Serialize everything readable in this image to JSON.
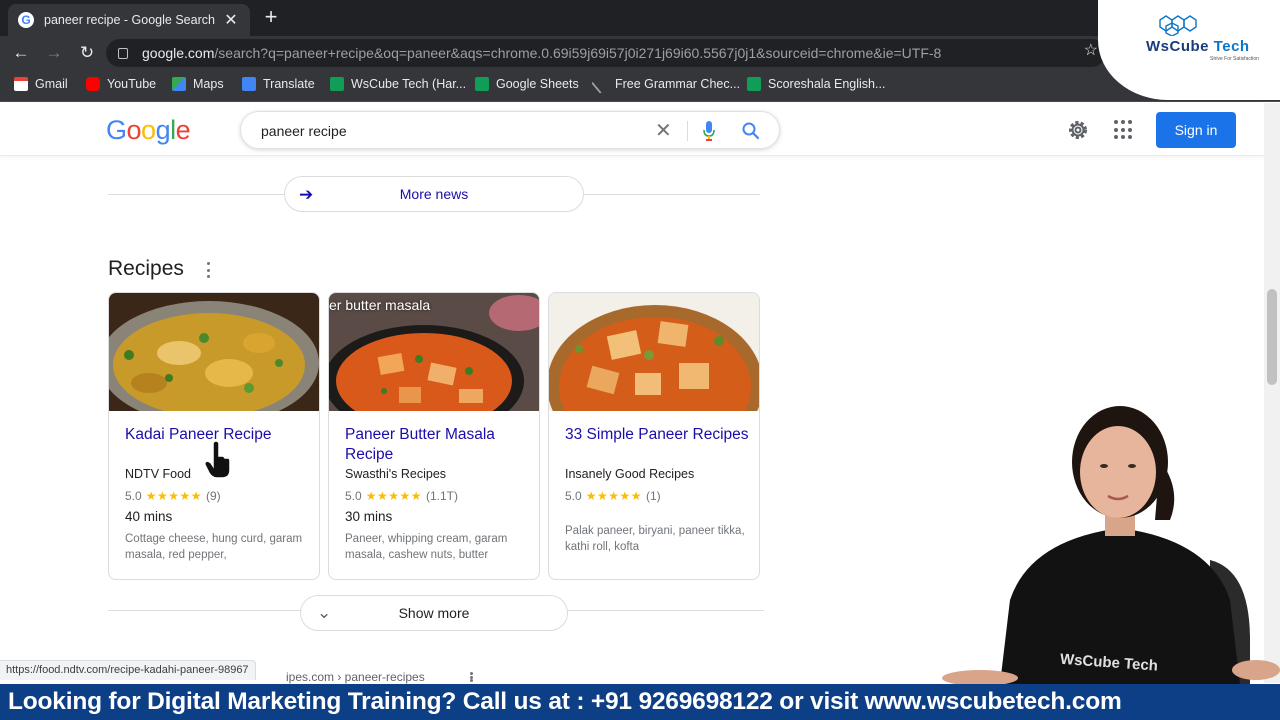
{
  "browser": {
    "tab_title": "paneer recipe - Google Search",
    "tab_close": "✕",
    "new_tab": "+",
    "url_host": "google.com",
    "url_rest": "/search?q=paneer+recipe&oq=paneer&aqs=chrome.0.69i59j69i57j0i271j69i60.5567j0j1&sourceid=chrome&ie=UTF-8",
    "bookmarks": [
      {
        "label": "Gmail",
        "color": "#ea4335"
      },
      {
        "label": "YouTube",
        "color": "#ff0000"
      },
      {
        "label": "Maps",
        "color": "#34a853"
      },
      {
        "label": "Translate",
        "color": "#4285f4"
      },
      {
        "label": "WsCube Tech (Har...",
        "color": "#0f9d58"
      },
      {
        "label": "Google Sheets",
        "color": "#0f9d58"
      },
      {
        "label": "Free Grammar Chec...",
        "color": "#9aa0a6"
      },
      {
        "label": "Scoreshala English...",
        "color": "#0f9d58"
      }
    ]
  },
  "watermark": {
    "brand_main": "WsCube ",
    "brand_accent": "Tech",
    "tagline": "Strive For Satisfaction"
  },
  "google": {
    "logo_letters": [
      "G",
      "o",
      "o",
      "g",
      "l",
      "e"
    ],
    "search_query": "paneer recipe",
    "sign_in_label": "Sign in"
  },
  "results": {
    "more_news_label": "More news",
    "recipes_title": "Recipes",
    "show_more_label": "Show more",
    "cards": [
      {
        "title": "Kadai Paneer Recipe",
        "source": "NDTV Food",
        "rating": "5.0",
        "stars": "★★★★★",
        "reviews": "(9)",
        "time": "40 mins",
        "ingredients": "Cottage cheese, hung curd, garam masala, red pepper,"
      },
      {
        "title": "Paneer Butter Masala Recipe",
        "source": "Swasthi's Recipes",
        "rating": "5.0",
        "stars": "★★★★★",
        "reviews": "(1.1T)",
        "time": "30 mins",
        "ingredients": "Paneer, whipping cream, garam masala, cashew nuts, butter",
        "image_caption": "er butter masala"
      },
      {
        "title": "33 Simple Paneer Recipes",
        "source": "Insanely Good Recipes",
        "rating": "5.0",
        "stars": "★★★★★",
        "reviews": "(1)",
        "time": "",
        "ingredients": "Palak paneer, biryani, paneer tikka, kathi roll, kofta"
      }
    ],
    "status_url": "https://food.ndtv.com/recipe-kadahi-paneer-98967",
    "partial_breadcrumb": "ipes.com › paneer-recipes"
  },
  "banner": {
    "text": "Looking for Digital Marketing Training? Call us at : +91 9269698122 or visit www.wscubetech.com"
  },
  "presenter_shirt_text": "WsCube Tech",
  "colors": {
    "link_blue": "#1a0dab",
    "signin_blue": "#1a73e8",
    "star_yellow": "#fbbc04",
    "banner_navy": "#0d3f86"
  }
}
